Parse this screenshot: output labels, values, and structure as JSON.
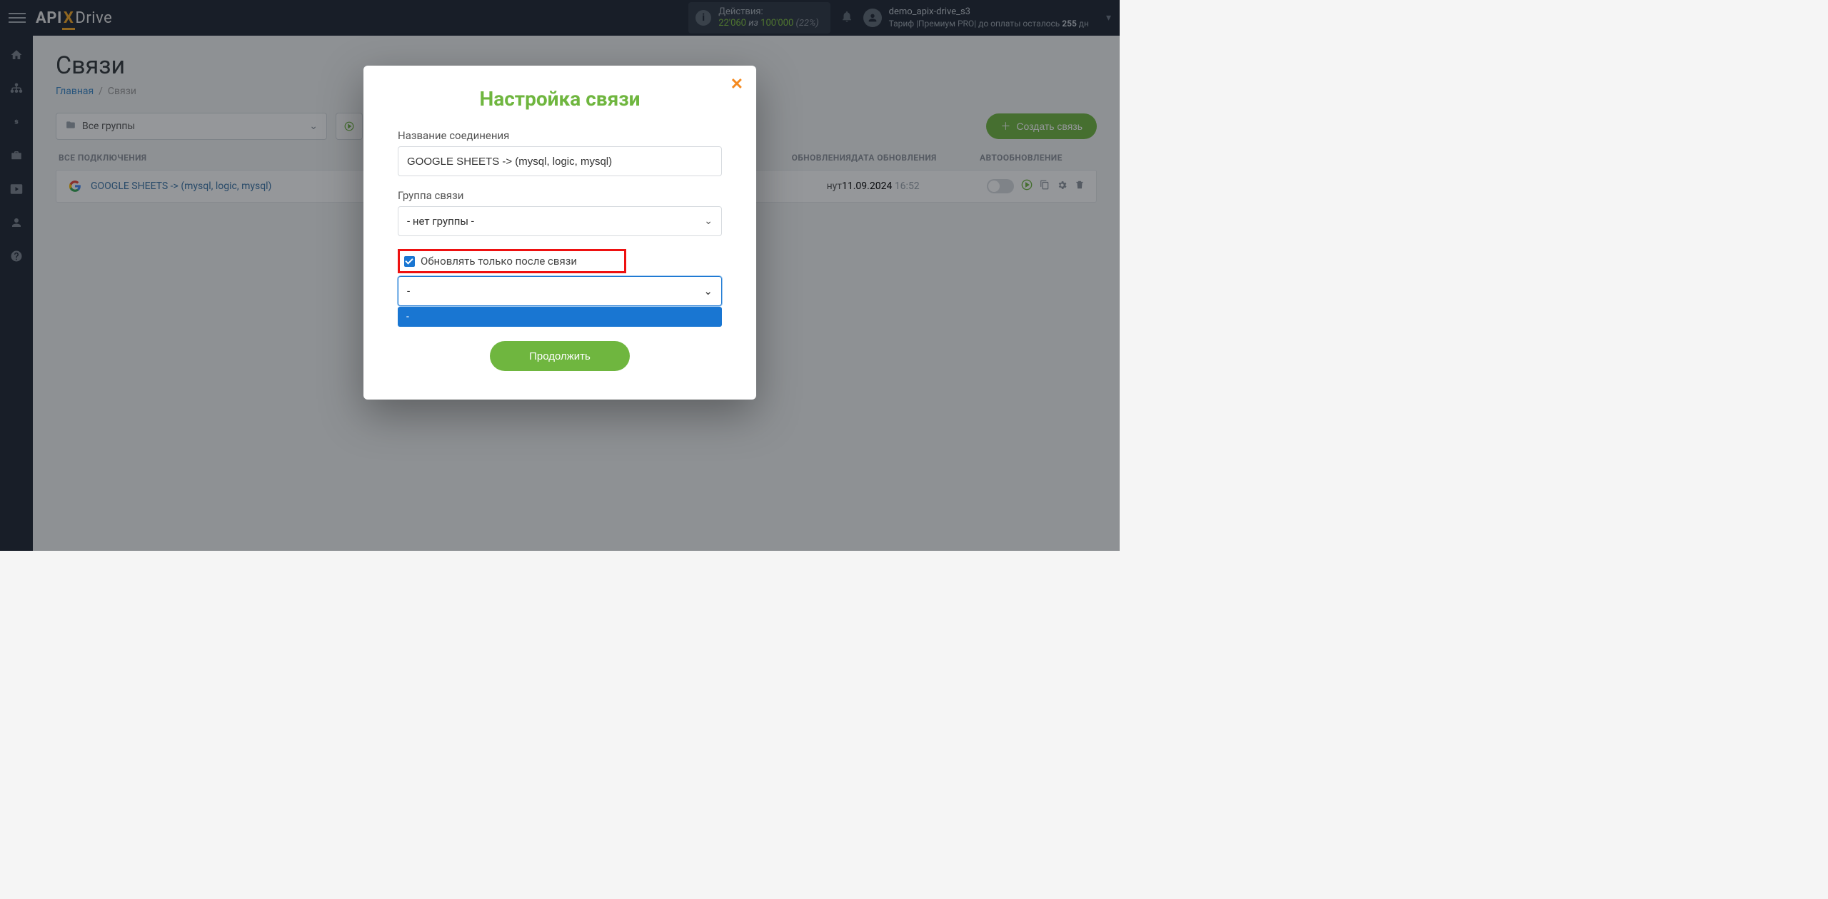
{
  "header": {
    "actions_label": "Действия:",
    "actions_used": "22'060",
    "actions_iz": "из",
    "actions_total": "100'000",
    "actions_pct": "(22%)",
    "username": "demo_apix-drive_s3",
    "tariff_prefix": "Тариф |Премиум PRO| до оплаты осталось ",
    "tariff_days": "255",
    "tariff_suffix": " дн"
  },
  "page": {
    "title": "Связи",
    "breadcrumb_home": "Главная",
    "breadcrumb_current": "Связи",
    "group_filter": "Все группы",
    "create_label": "Создать связь",
    "col_all": "ВСЕ ПОДКЛЮЧЕНИЯ",
    "col_refresh": "ОБНОВЛЕНИЯ",
    "col_date": "ДАТА ОБНОВЛЕНИЯ",
    "col_auto": "АВТООБНОВЛЕНИЕ"
  },
  "row": {
    "name": "GOOGLE SHEETS -> (mysql, logic, mysql)",
    "refresh_suffix": "нут",
    "date": "11.09.2024",
    "time": "16:52"
  },
  "modal": {
    "title": "Настройка связи",
    "name_label": "Название соединения",
    "name_value": "GOOGLE SHEETS -> (mysql, logic, mysql)",
    "group_label": "Группа связи",
    "group_value": "- нет группы -",
    "checkbox_label": "Обновлять только после связи",
    "dep_value": "-",
    "dropdown_option": "-",
    "continue": "Продолжить"
  }
}
